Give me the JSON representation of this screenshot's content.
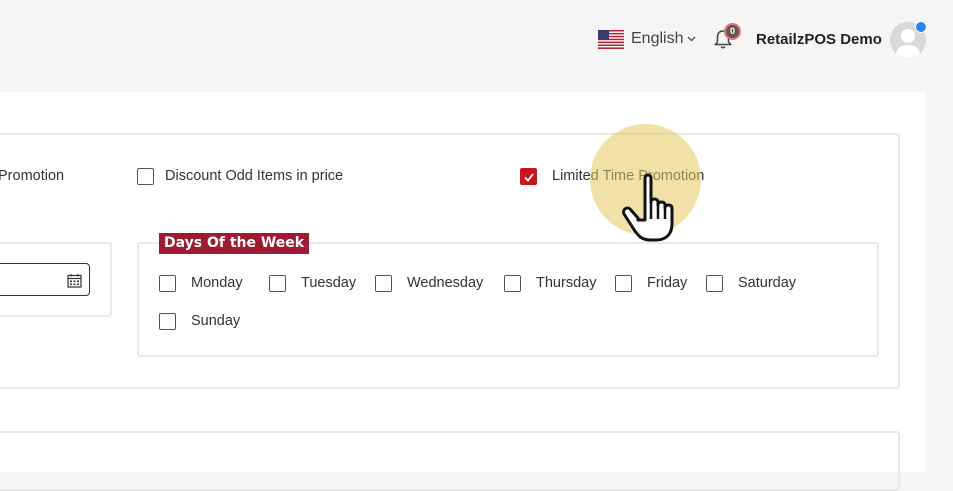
{
  "header": {
    "language": "English",
    "flag_icon": "us-flag-icon",
    "notification_count": "0",
    "user_name": "RetailzPOS Demo"
  },
  "promotion_options": {
    "left_cut_label": "Promotion",
    "discount_odd_items": {
      "label": "Discount Odd Items in price",
      "checked": false
    },
    "limited_time": {
      "label": "Limited Time Promotion",
      "checked": true
    }
  },
  "days_of_week": {
    "legend": "Days Of the Week",
    "days": [
      {
        "label": "Monday",
        "checked": false
      },
      {
        "label": "Tuesday",
        "checked": false
      },
      {
        "label": "Wednesday",
        "checked": false
      },
      {
        "label": "Thursday",
        "checked": false
      },
      {
        "label": "Friday",
        "checked": false
      },
      {
        "label": "Saturday",
        "checked": false
      },
      {
        "label": "Sunday",
        "checked": false
      }
    ]
  },
  "colors": {
    "accent": "#c8161d",
    "legend_bg": "#9e1b32",
    "highlight": "#e4c95e"
  }
}
